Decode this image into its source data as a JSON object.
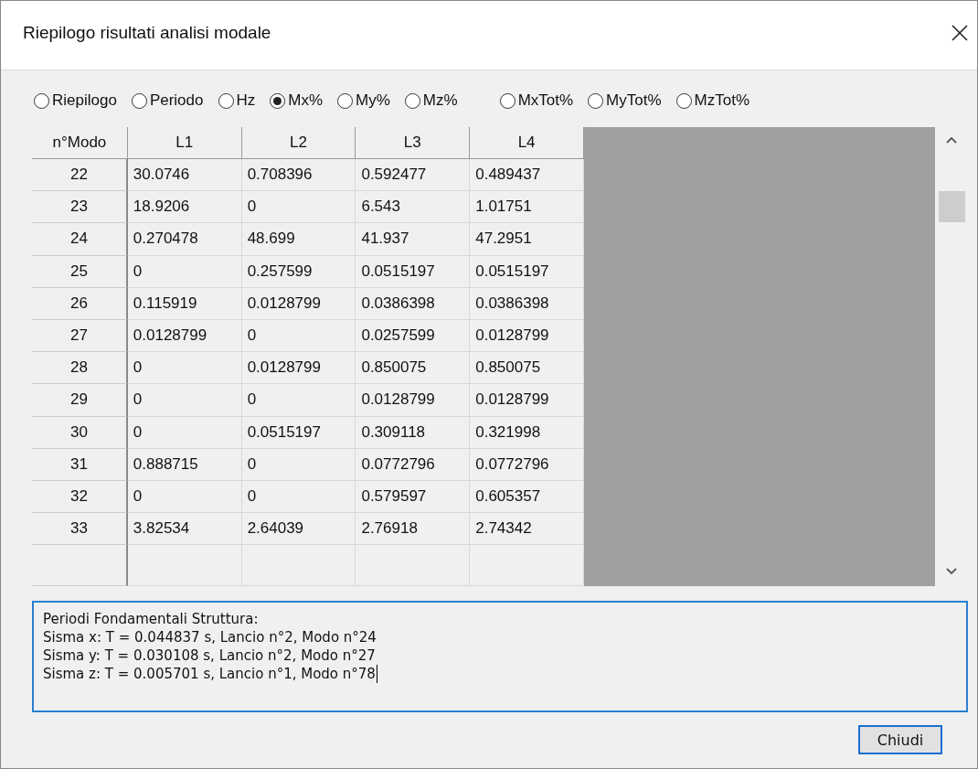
{
  "window": {
    "title": "Riepilogo risultati analisi modale"
  },
  "radios": [
    {
      "label": "Riepilogo",
      "selected": false
    },
    {
      "label": "Periodo",
      "selected": false
    },
    {
      "label": "Hz",
      "selected": false
    },
    {
      "label": "Mx%",
      "selected": true
    },
    {
      "label": "My%",
      "selected": false
    },
    {
      "label": "Mz%",
      "selected": false
    },
    {
      "label": "MxTot%",
      "selected": false
    },
    {
      "label": "MyTot%",
      "selected": false
    },
    {
      "label": "MzTot%",
      "selected": false
    }
  ],
  "table": {
    "columns": [
      "n°Modo",
      "L1",
      "L2",
      "L3",
      "L4"
    ],
    "rows": [
      [
        "22",
        "30.0746",
        "0.708396",
        "0.592477",
        "0.489437"
      ],
      [
        "23",
        "18.9206",
        "0",
        "6.543",
        "1.01751"
      ],
      [
        "24",
        "0.270478",
        "48.699",
        "41.937",
        "47.2951"
      ],
      [
        "25",
        "0",
        "0.257599",
        "0.0515197",
        "0.0515197"
      ],
      [
        "26",
        "0.115919",
        "0.0128799",
        "0.0386398",
        "0.0386398"
      ],
      [
        "27",
        "0.0128799",
        "0",
        "0.0257599",
        "0.0128799"
      ],
      [
        "28",
        "0",
        "0.0128799",
        "0.850075",
        "0.850075"
      ],
      [
        "29",
        "0",
        "0",
        "0.0128799",
        "0.0128799"
      ],
      [
        "30",
        "0",
        "0.0515197",
        "0.309118",
        "0.321998"
      ],
      [
        "31",
        "0.888715",
        "0",
        "0.0772796",
        "0.0772796"
      ],
      [
        "32",
        "0",
        "0",
        "0.579597",
        "0.605357"
      ],
      [
        "33",
        "3.82534",
        "2.64039",
        "2.76918",
        "2.74342"
      ]
    ]
  },
  "summary": {
    "lines": [
      "Periodi Fondamentali Struttura:",
      "Sisma x: T = 0.044837 s, Lancio n°2, Modo n°24",
      "Sisma y: T = 0.030108 s, Lancio n°2, Modo n°27",
      "Sisma z: T = 0.005701 s, Lancio n°1, Modo n°78"
    ]
  },
  "buttons": [
    "Chiudi"
  ]
}
